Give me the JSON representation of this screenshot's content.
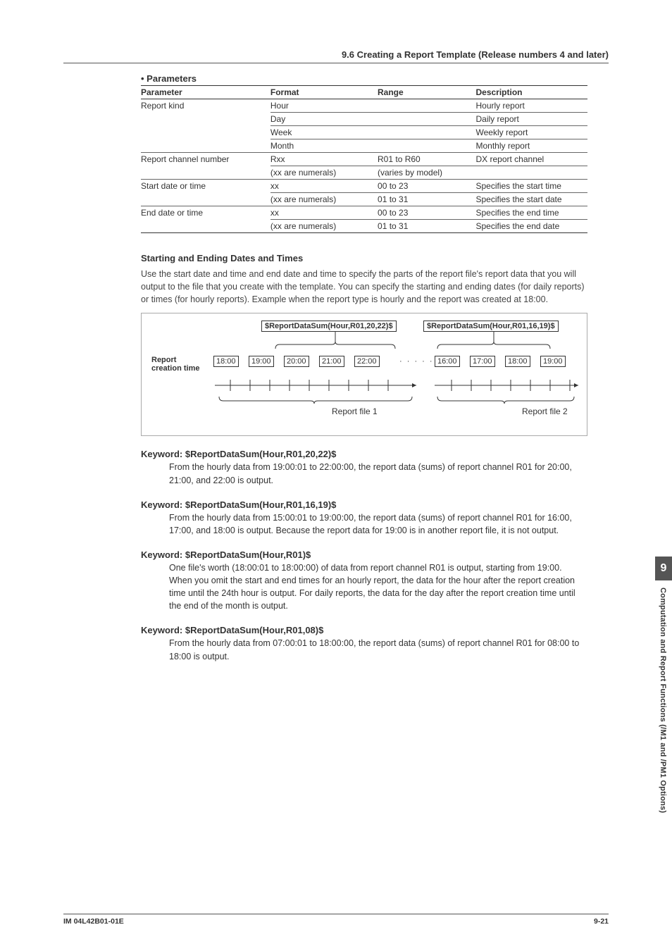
{
  "header": {
    "section_title": "9.6  Creating a Report Template (Release numbers 4 and later)"
  },
  "params": {
    "heading": "•  Parameters",
    "cols": {
      "c1": "Parameter",
      "c2": "Format",
      "c3": "Range",
      "c4": "Description"
    },
    "rows": [
      {
        "p": "Report kind",
        "f": "Hour",
        "r": "",
        "d": "Hourly report"
      },
      {
        "p": "",
        "f": "Day",
        "r": "",
        "d": "Daily report"
      },
      {
        "p": "",
        "f": "Week",
        "r": "",
        "d": "Weekly report"
      },
      {
        "p": "",
        "f": "Month",
        "r": "",
        "d": "Monthly report"
      },
      {
        "p": "Report channel number",
        "f": "Rxx",
        "r": "R01 to R60",
        "d": "DX report channel"
      },
      {
        "p": "",
        "f": "(xx are numerals)",
        "r": "(varies by model)",
        "d": ""
      },
      {
        "p": "Start date or time",
        "f": "xx",
        "r": "00 to 23",
        "d": "Specifies the start time"
      },
      {
        "p": "",
        "f": "(xx are numerals)",
        "r": "01 to 31",
        "d": "Specifies the start date"
      },
      {
        "p": "End date or time",
        "f": "xx",
        "r": "00 to 23",
        "d": "Specifies the end time"
      },
      {
        "p": "",
        "f": "(xx are numerals)",
        "r": "01 to 31",
        "d": "Specifies the end date"
      }
    ]
  },
  "starting": {
    "heading": "Starting and Ending Dates and Times",
    "body": "Use the start date and time and end date and time to specify the parts of the report file's report data that you will output to the file that you create with the template. You can specify the starting and ending dates (for daily reports) or times (for hourly reports). Example when the report type is hourly and the report was created at 18:00."
  },
  "diagram": {
    "kw1": "$ReportDataSum(Hour,R01,20,22)$",
    "kw2": "$ReportDataSum(Hour,R01,16,19)$",
    "side_label_1": "Report",
    "side_label_2": "creation time",
    "times_left": [
      "18:00",
      "19:00",
      "20:00",
      "21:00",
      "22:00"
    ],
    "dots": "· · · · ·",
    "times_right": [
      "16:00",
      "17:00",
      "18:00",
      "19:00"
    ],
    "file1": "Report file 1",
    "file2": "Report file 2"
  },
  "kw_sections": [
    {
      "heading": "Keyword: $ReportDataSum(Hour,R01,20,22)$",
      "body": "From the hourly data from 19:00:01 to 22:00:00, the report data (sums) of report channel R01 for 20:00, 21:00, and 22:00 is output."
    },
    {
      "heading": "Keyword: $ReportDataSum(Hour,R01,16,19)$",
      "body": "From the hourly data from 15:00:01 to 19:00:00, the report data (sums) of report channel R01 for 16:00, 17:00, and 18:00 is output. Because the report data for 19:00 is in another report file, it is not output."
    },
    {
      "heading": "Keyword: $ReportDataSum(Hour,R01)$",
      "body": "One file's worth (18:00:01 to 18:00:00) of data from report channel R01 is output, starting from 19:00.\nWhen you omit the start and end times for an hourly report, the data for the hour after the report creation time until the 24th hour is output. For daily reports, the data for the day after the report creation time until the end of the month is output."
    },
    {
      "heading": "Keyword: $ReportDataSum(Hour,R01,08)$",
      "body": "From the hourly data from 07:00:01 to 18:00:00, the report data (sums) of report channel R01 for 08:00 to 18:00 is output."
    }
  ],
  "sidetab": {
    "number": "9",
    "text": "Computation and Report Functions (/M1 and /PM1 Options)"
  },
  "footer": {
    "left": "IM 04L42B01-01E",
    "right": "9-21"
  }
}
